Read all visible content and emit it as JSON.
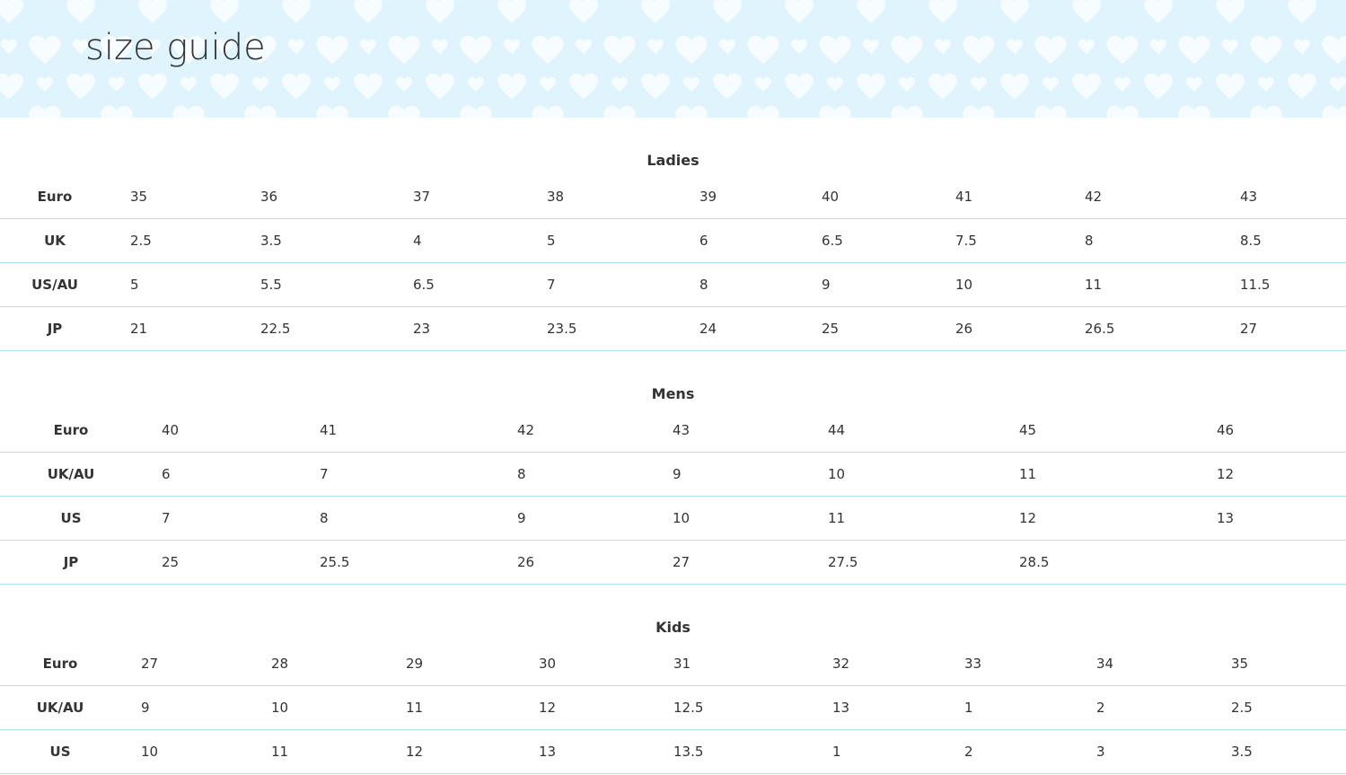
{
  "page": {
    "title": "size guide"
  },
  "colors": {
    "banner_bg": "#dff4fd",
    "heart": "#f6fcff",
    "divider": "#aee3ee",
    "text": "#333333"
  },
  "tables": [
    {
      "title": "Ladies",
      "rows": [
        {
          "label": "Euro",
          "values": [
            "35",
            "36",
            "37",
            "38",
            "39",
            "40",
            "41",
            "42",
            "43"
          ]
        },
        {
          "label": "UK",
          "values": [
            "2.5",
            "3.5",
            "4",
            "5",
            "6",
            "6.5",
            "7.5",
            "8",
            "8.5"
          ]
        },
        {
          "label": "US/AU",
          "values": [
            "5",
            "5.5",
            "6.5",
            "7",
            "8",
            "9",
            "10",
            "11",
            "11.5"
          ]
        },
        {
          "label": "JP",
          "values": [
            "21",
            "22.5",
            "23",
            "23.5",
            "24",
            "25",
            "26",
            "26.5",
            "27"
          ]
        }
      ]
    },
    {
      "title": "Mens",
      "rows": [
        {
          "label": "Euro",
          "values": [
            "40",
            "41",
            "42",
            "43",
            "44",
            "45",
            "46"
          ]
        },
        {
          "label": "UK/AU",
          "values": [
            "6",
            "7",
            "8",
            "9",
            "10",
            "11",
            "12"
          ]
        },
        {
          "label": "US",
          "values": [
            "7",
            "8",
            "9",
            "10",
            "11",
            "12",
            "13"
          ]
        },
        {
          "label": "JP",
          "values": [
            "25",
            "25.5",
            "26",
            "27",
            "27.5",
            "28.5",
            ""
          ]
        }
      ]
    },
    {
      "title": "Kids",
      "rows": [
        {
          "label": "Euro",
          "values": [
            "27",
            "28",
            "29",
            "30",
            "31",
            "32",
            "33",
            "34",
            "35"
          ]
        },
        {
          "label": "UK/AU",
          "values": [
            "9",
            "10",
            "11",
            "12",
            "12.5",
            "13",
            "1",
            "2",
            "2.5"
          ]
        },
        {
          "label": "US",
          "values": [
            "10",
            "11",
            "12",
            "13",
            "13.5",
            "1",
            "2",
            "3",
            "3.5"
          ]
        }
      ]
    }
  ]
}
